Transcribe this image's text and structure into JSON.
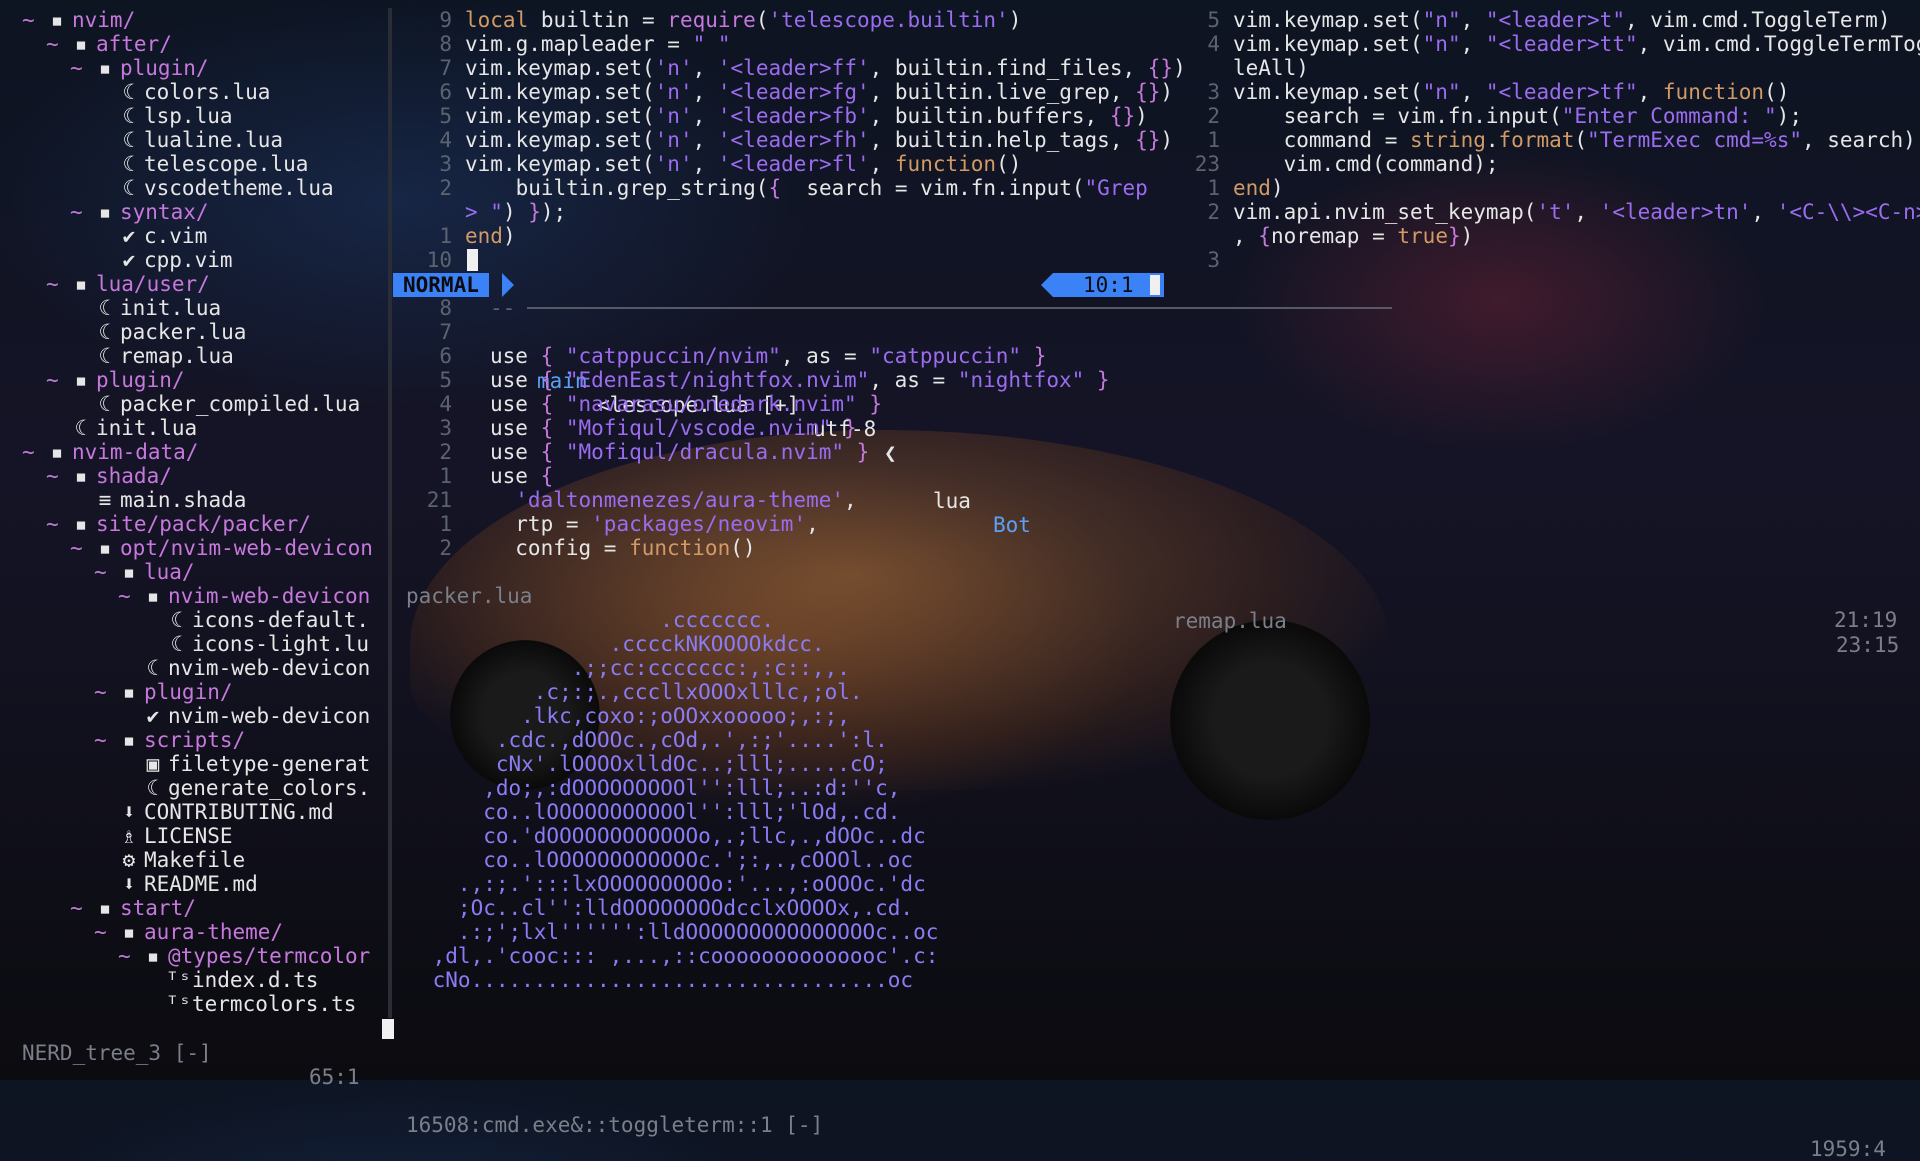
{
  "tree": {
    "rows": [
      {
        "fold": "~",
        "icon": "folder",
        "label": "nvim/",
        "indent": 0
      },
      {
        "fold": "~",
        "icon": "folder",
        "label": "after/",
        "indent": 1
      },
      {
        "fold": "~",
        "icon": "folder",
        "label": "plugin/",
        "indent": 2
      },
      {
        "fold": "",
        "icon": "lua",
        "label": "colors.lua",
        "indent": 3
      },
      {
        "fold": "",
        "icon": "lua",
        "label": "lsp.lua",
        "indent": 3
      },
      {
        "fold": "",
        "icon": "lua",
        "label": "lualine.lua",
        "indent": 3
      },
      {
        "fold": "",
        "icon": "lua",
        "label": "telescope.lua",
        "indent": 3
      },
      {
        "fold": "",
        "icon": "lua",
        "label": "vscodetheme.lua",
        "indent": 3
      },
      {
        "fold": "~",
        "icon": "folder",
        "label": "syntax/",
        "indent": 2
      },
      {
        "fold": "",
        "icon": "vim",
        "label": "c.vim",
        "indent": 3
      },
      {
        "fold": "",
        "icon": "vim",
        "label": "cpp.vim",
        "indent": 3
      },
      {
        "fold": "~",
        "icon": "folder",
        "label": "lua/user/",
        "indent": 1
      },
      {
        "fold": "",
        "icon": "lua",
        "label": "init.lua",
        "indent": 2
      },
      {
        "fold": "",
        "icon": "lua",
        "label": "packer.lua",
        "indent": 2
      },
      {
        "fold": "",
        "icon": "lua",
        "label": "remap.lua",
        "indent": 2
      },
      {
        "fold": "~",
        "icon": "folder",
        "label": "plugin/",
        "indent": 1
      },
      {
        "fold": "",
        "icon": "lua",
        "label": "packer_compiled.lua",
        "indent": 2
      },
      {
        "fold": "",
        "icon": "lua",
        "label": "init.lua",
        "indent": 1
      },
      {
        "fold": "~",
        "icon": "folder",
        "label": "nvim-data/",
        "indent": 0
      },
      {
        "fold": "~",
        "icon": "folder",
        "label": "shada/",
        "indent": 1
      },
      {
        "fold": "",
        "icon": "text",
        "label": "main.shada",
        "indent": 2
      },
      {
        "fold": "~",
        "icon": "folder",
        "label": "site/pack/packer/",
        "indent": 1
      },
      {
        "fold": "~",
        "icon": "folder",
        "label": "opt/nvim-web-devicon",
        "indent": 2
      },
      {
        "fold": "~",
        "icon": "folder",
        "label": "lua/",
        "indent": 3
      },
      {
        "fold": "~",
        "icon": "folder",
        "label": "nvim-web-devicon",
        "indent": 4
      },
      {
        "fold": "",
        "icon": "lua",
        "label": "icons-default.",
        "indent": 5
      },
      {
        "fold": "",
        "icon": "lua",
        "label": "icons-light.lu",
        "indent": 5
      },
      {
        "fold": "",
        "icon": "lua",
        "label": "nvim-web-devicon",
        "indent": 4
      },
      {
        "fold": "~",
        "icon": "folder",
        "label": "plugin/",
        "indent": 3
      },
      {
        "fold": "",
        "icon": "vim",
        "label": "nvim-web-devicon",
        "indent": 4
      },
      {
        "fold": "~",
        "icon": "folder",
        "label": "scripts/",
        "indent": 3
      },
      {
        "fold": "",
        "icon": "script",
        "label": "filetype-generat",
        "indent": 4
      },
      {
        "fold": "",
        "icon": "lua",
        "label": "generate_colors.",
        "indent": 4
      },
      {
        "fold": "",
        "icon": "md",
        "label": "CONTRIBUTING.md",
        "indent": 3
      },
      {
        "fold": "",
        "icon": "license",
        "label": "LICENSE",
        "indent": 3
      },
      {
        "fold": "",
        "icon": "gear",
        "label": "Makefile",
        "indent": 3
      },
      {
        "fold": "",
        "icon": "md",
        "label": "README.md",
        "indent": 3
      },
      {
        "fold": "~",
        "icon": "folder",
        "label": "start/",
        "indent": 2
      },
      {
        "fold": "~",
        "icon": "folder",
        "label": "aura-theme/",
        "indent": 3
      },
      {
        "fold": "~",
        "icon": "folder",
        "label": "@types/termcolor",
        "indent": 4
      },
      {
        "fold": "",
        "icon": "ts",
        "label": "index.d.ts",
        "indent": 5
      },
      {
        "fold": "",
        "icon": "ts",
        "label": "termcolors.ts",
        "indent": 5
      }
    ],
    "status_name": "NERD_tree_3 [-]",
    "status_pos": "65:1"
  },
  "telescope_pane": {
    "lines": [
      {
        "ln": "9",
        "segs": [
          [
            "kw",
            "local"
          ],
          [
            "id",
            " builtin = "
          ],
          [
            "fn",
            "require"
          ],
          [
            "id",
            "("
          ],
          [
            "str",
            "'telescope.builtin'"
          ],
          [
            "id",
            ")"
          ]
        ]
      },
      {
        "ln": "8",
        "segs": [
          [
            "id",
            "vim.g.mapleader = "
          ],
          [
            "str",
            "\" \""
          ]
        ]
      },
      {
        "ln": "7",
        "segs": [
          [
            "id",
            "vim.keymap.set("
          ],
          [
            "str",
            "'n'"
          ],
          [
            "id",
            ", "
          ],
          [
            "str",
            "'<leader>ff'"
          ],
          [
            "id",
            ", builtin.find_files, "
          ],
          [
            "fn",
            "{}"
          ],
          [
            "id",
            ")"
          ]
        ]
      },
      {
        "ln": "6",
        "segs": [
          [
            "id",
            "vim.keymap.set("
          ],
          [
            "str",
            "'n'"
          ],
          [
            "id",
            ", "
          ],
          [
            "str",
            "'<leader>fg'"
          ],
          [
            "id",
            ", builtin.live_grep, "
          ],
          [
            "fn",
            "{}"
          ],
          [
            "id",
            ")"
          ]
        ]
      },
      {
        "ln": "5",
        "segs": [
          [
            "id",
            "vim.keymap.set("
          ],
          [
            "str",
            "'n'"
          ],
          [
            "id",
            ", "
          ],
          [
            "str",
            "'<leader>fb'"
          ],
          [
            "id",
            ", builtin.buffers, "
          ],
          [
            "fn",
            "{}"
          ],
          [
            "id",
            ")"
          ]
        ]
      },
      {
        "ln": "4",
        "segs": [
          [
            "id",
            "vim.keymap.set("
          ],
          [
            "str",
            "'n'"
          ],
          [
            "id",
            ", "
          ],
          [
            "str",
            "'<leader>fh'"
          ],
          [
            "id",
            ", builtin.help_tags, "
          ],
          [
            "fn",
            "{}"
          ],
          [
            "id",
            ")"
          ]
        ]
      },
      {
        "ln": "3",
        "segs": [
          [
            "id",
            "vim.keymap.set("
          ],
          [
            "str",
            "'n'"
          ],
          [
            "id",
            ", "
          ],
          [
            "str",
            "'<leader>fl'"
          ],
          [
            "id",
            ", "
          ],
          [
            "kw",
            "function"
          ],
          [
            "id",
            "()"
          ]
        ]
      },
      {
        "ln": "2",
        "segs": [
          [
            "id",
            "    builtin.grep_string("
          ],
          [
            "fn",
            "{"
          ],
          [
            "id",
            "  search = vim.fn.input("
          ],
          [
            "str",
            "\"Grep"
          ]
        ]
      },
      {
        "ln": "",
        "segs": [
          [
            "str",
            "> \""
          ],
          [
            "id",
            ") "
          ],
          [
            "fn",
            "}"
          ],
          [
            "id",
            ");"
          ]
        ]
      },
      {
        "ln": "1",
        "segs": [
          [
            "kw",
            "end"
          ],
          [
            "id",
            ")"
          ]
        ]
      },
      {
        "ln": "10",
        "segs": []
      }
    ]
  },
  "remap_pane": {
    "lines": [
      {
        "ln": "5",
        "segs": [
          [
            "id",
            "vim.keymap.set("
          ],
          [
            "str",
            "\"n\""
          ],
          [
            "id",
            ", "
          ],
          [
            "str",
            "\"<leader>t\""
          ],
          [
            "id",
            ", vim.cmd.ToggleTerm)"
          ]
        ]
      },
      {
        "ln": "4",
        "segs": [
          [
            "id",
            "vim.keymap.set("
          ],
          [
            "str",
            "\"n\""
          ],
          [
            "id",
            ", "
          ],
          [
            "str",
            "\"<leader>tt\""
          ],
          [
            "id",
            ", vim.cmd.ToggleTermTogg"
          ]
        ]
      },
      {
        "ln": "",
        "segs": [
          [
            "id",
            "leAll)"
          ]
        ]
      },
      {
        "ln": "3",
        "segs": [
          [
            "id",
            "vim.keymap.set("
          ],
          [
            "str",
            "\"n\""
          ],
          [
            "id",
            ", "
          ],
          [
            "str",
            "\"<leader>tf\""
          ],
          [
            "id",
            ", "
          ],
          [
            "kw",
            "function"
          ],
          [
            "id",
            "()"
          ]
        ]
      },
      {
        "ln": "2",
        "segs": [
          [
            "id",
            "    search = vim.fn.input("
          ],
          [
            "str",
            "\"Enter Command: \""
          ],
          [
            "id",
            ");"
          ]
        ]
      },
      {
        "ln": "1",
        "segs": [
          [
            "id",
            "    command = "
          ],
          [
            "kw",
            "string"
          ],
          [
            "id",
            "."
          ],
          [
            "kw",
            "format"
          ],
          [
            "id",
            "("
          ],
          [
            "str",
            "\"TermExec cmd=%s\""
          ],
          [
            "id",
            ", search);"
          ]
        ]
      },
      {
        "ln": "23",
        "segs": [
          [
            "id",
            "    vim.cmd(command);"
          ]
        ]
      },
      {
        "ln": "1",
        "segs": [
          [
            "kw",
            "end"
          ],
          [
            "id",
            ")"
          ]
        ]
      },
      {
        "ln": "2",
        "segs": [
          [
            "id",
            "vim.api.nvim_set_keymap("
          ],
          [
            "str",
            "'t'"
          ],
          [
            "id",
            ", "
          ],
          [
            "str",
            "'<leader>tn'"
          ],
          [
            "id",
            ", "
          ],
          [
            "str",
            "'<C-\\\\><C-n>'"
          ]
        ]
      },
      {
        "ln": "",
        "segs": [
          [
            "id",
            ", "
          ],
          [
            "fn",
            "{"
          ],
          [
            "id",
            "noremap = "
          ],
          [
            "kw",
            "true"
          ],
          [
            "fn",
            "}"
          ],
          [
            "id",
            ")"
          ]
        ]
      },
      {
        "ln": "3",
        "segs": []
      }
    ]
  },
  "statusline": {
    "mode": "NORMAL",
    "branch_icon": "",
    "branch": "main",
    "file": "<lescope.lua [+]",
    "encoding": "utf-8",
    "ft_icon": "",
    "filetype": "lua",
    "scroll": "Bot",
    "position": "10:1",
    "inactive_file": "remap.lua",
    "inactive_pos": "23:15"
  },
  "packer_pane": {
    "lines": [
      {
        "ln": "8",
        "segs": [
          [
            "ln",
            "--"
          ]
        ]
      },
      {
        "ln": "7",
        "segs": []
      },
      {
        "ln": "6",
        "segs": [
          [
            "id",
            "use "
          ],
          [
            "fn",
            "{ "
          ],
          [
            "str",
            "\"catppuccin/nvim\""
          ],
          [
            "id",
            ", as = "
          ],
          [
            "str",
            "\"catppuccin\""
          ],
          [
            "fn",
            " }"
          ]
        ]
      },
      {
        "ln": "5",
        "segs": [
          [
            "id",
            "use "
          ],
          [
            "fn",
            "{ "
          ],
          [
            "str",
            "\"EdenEast/nightfox.nvim\""
          ],
          [
            "id",
            ", as = "
          ],
          [
            "str",
            "\"nightfox\""
          ],
          [
            "fn",
            " }"
          ]
        ]
      },
      {
        "ln": "4",
        "segs": [
          [
            "id",
            "use "
          ],
          [
            "fn",
            "{ "
          ],
          [
            "str",
            "\"navarasu/onedark.nvim\""
          ],
          [
            "fn",
            " }"
          ]
        ]
      },
      {
        "ln": "3",
        "segs": [
          [
            "id",
            "use "
          ],
          [
            "fn",
            "{ "
          ],
          [
            "str",
            "\"Mofiqul/vscode.nvim\""
          ],
          [
            "fn",
            " }"
          ]
        ]
      },
      {
        "ln": "2",
        "segs": [
          [
            "id",
            "use "
          ],
          [
            "fn",
            "{ "
          ],
          [
            "str",
            "\"Mofiqul/dracula.nvim\""
          ],
          [
            "fn",
            " }"
          ]
        ]
      },
      {
        "ln": "1",
        "segs": [
          [
            "id",
            "use "
          ],
          [
            "fn",
            "{"
          ]
        ]
      },
      {
        "ln": "21",
        "segs": [
          [
            "str",
            "  'daltonmenezes/aura-theme'"
          ],
          [
            "id",
            ","
          ]
        ]
      },
      {
        "ln": "1",
        "segs": [
          [
            "id",
            "  rtp = "
          ],
          [
            "str",
            "'packages/neovim'"
          ],
          [
            "id",
            ","
          ]
        ]
      },
      {
        "ln": "2",
        "segs": [
          [
            "id",
            "  config = "
          ],
          [
            "kw",
            "function"
          ],
          [
            "id",
            "()"
          ]
        ]
      }
    ],
    "status_file": "packer.lua",
    "status_pos": "21:19"
  },
  "ascii_art": [
    "                   .ccccccc.",
    "               .cccckNKOOOOkdcc.",
    "            .;;cc:ccccccc:,:c::,,.",
    "         .c;:;.,cccllxOOOxlllc,;ol.",
    "        .lkc,coxo:;oOOxxooooo;,:;,",
    "      .cdc.,dOOOc.,cOd,.',:;'....':l.",
    "      cNx'.lOOOOxlldOc..;lll;.....cO;",
    "     ,do;,:dOOOOOOOOOl'':lll;..:d:''c,",
    "     co..lOOOOOOOOOOOl'':lll;'lOd,.cd.",
    "     co.'dOOOOOOOOOOOOo,.;llc,.,dOOc..dc",
    "     co..lOOOOOOOOOOOOc.';:,.,cOOOl..oc",
    "   .,:;.':::lxOOOOOOOOOo:'...,:oOOOc.'dc",
    "   ;Oc..cl'':lldOOOOOOOOdcclxOOOOx,.cd.",
    "   .:;';lxl'''''':lldOOOOOOOOOOOOOOOc..oc",
    " ,dl,.'cooc::: ,...,::coooooooooooooc'.c:",
    " cNo.................................oc"
  ],
  "terminal": {
    "status_name": "16508:cmd.exe&::toggleterm::1 [-]",
    "status_pos": "1959:4"
  },
  "icons": {
    "folder": "▪",
    "lua": "☾",
    "vim": "✔",
    "text": "≡",
    "script": "▣",
    "md": "⬇",
    "license": "♗",
    "gear": "⚙",
    "ts": "ᵀˢ"
  }
}
